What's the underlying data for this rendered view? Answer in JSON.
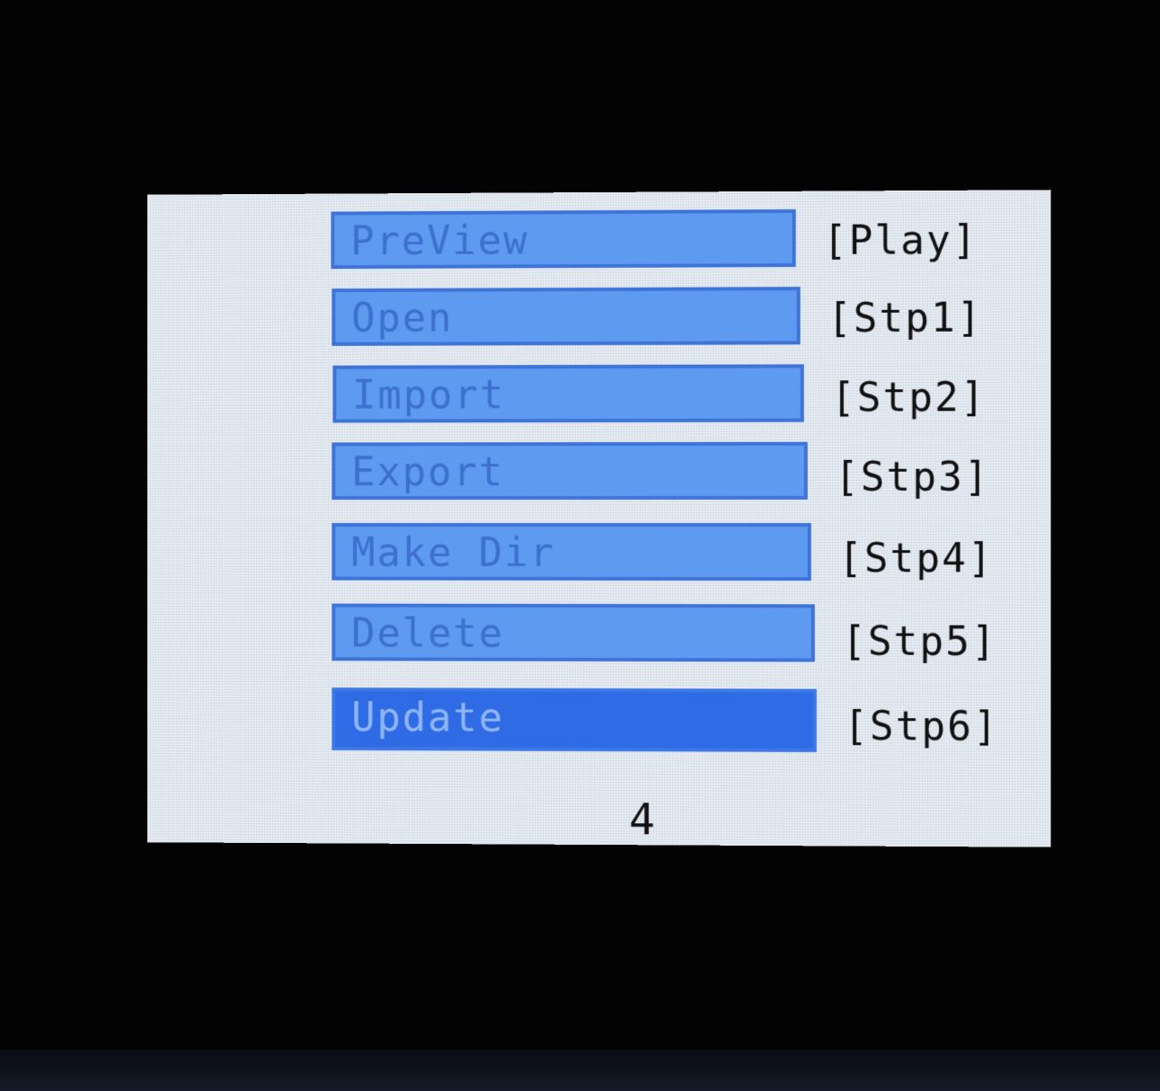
{
  "menu": {
    "items": [
      {
        "label": "PreView",
        "shortcut": "[Play]"
      },
      {
        "label": "Open",
        "shortcut": "[Stp1]"
      },
      {
        "label": "Import",
        "shortcut": "[Stp2]"
      },
      {
        "label": "Export",
        "shortcut": "[Stp3]"
      },
      {
        "label": "Make Dir",
        "shortcut": "[Stp4]"
      },
      {
        "label": "Delete",
        "shortcut": "[Stp5]"
      },
      {
        "label": "Update",
        "shortcut": "[Stp6]"
      }
    ],
    "selected_label": "Update"
  },
  "footer": {
    "value": "4"
  },
  "colors": {
    "button_fill": "#5d9af0",
    "button_selected_fill": "#2f6be4",
    "screen_background": "#e8eef6"
  }
}
